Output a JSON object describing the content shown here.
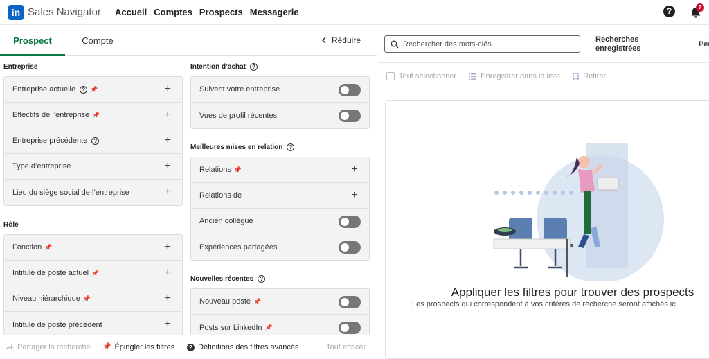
{
  "nav": {
    "brand": "Sales Navigator",
    "logo_text": "in",
    "links": [
      "Accueil",
      "Comptes",
      "Prospects",
      "Messagerie"
    ],
    "help_glyph": "?",
    "notifications_count": "7"
  },
  "tabs": {
    "prospect": "Prospect",
    "compte": "Compte",
    "reduce": "Réduire"
  },
  "sections": {
    "entreprise": "Entreprise",
    "role": "Rôle",
    "intention": "Intention d’achat",
    "relations": "Meilleures mises en relation",
    "nouvelles": "Nouvelles récentes"
  },
  "filters": {
    "entreprise": [
      "Entreprise actuelle",
      "Effectifs de l’entreprise",
      "Entreprise précédente",
      "Type d’entreprise",
      "Lieu du siège social de l’entreprise"
    ],
    "role": [
      "Fonction",
      "Intitulé de poste actuel",
      "Niveau hiérarchique",
      "Intitulé de poste précédent"
    ],
    "intention": [
      "Suivent votre entreprise",
      "Vues de profil récentes"
    ],
    "relations": [
      "Relations",
      "Relations de",
      "Ancien collègue",
      "Expériences partagées"
    ],
    "nouvelles": [
      "Nouveau poste",
      "Posts sur LinkedIn"
    ]
  },
  "footer": {
    "share": "Partager la recherche",
    "pin": "Épingler les filtres",
    "definitions": "Définitions des filtres avancés",
    "clear": "Tout effacer"
  },
  "right": {
    "search_placeholder": "Rechercher des mots-clés",
    "saved_line1": "Recherches",
    "saved_line2": "enregistrées",
    "per": "Per",
    "select_all": "Tout sélectionner",
    "save_list": "Enregistrer dans la liste",
    "remove": "Retirer",
    "empty_title": "Appliquer les filtres pour trouver des prospects",
    "empty_sub": "Les prospects qui correspondent à vos critères de recherche seront affichés ic"
  },
  "colors": {
    "brand": "#0a66c2",
    "accent_green": "#057642",
    "badge": "#cb112d"
  }
}
